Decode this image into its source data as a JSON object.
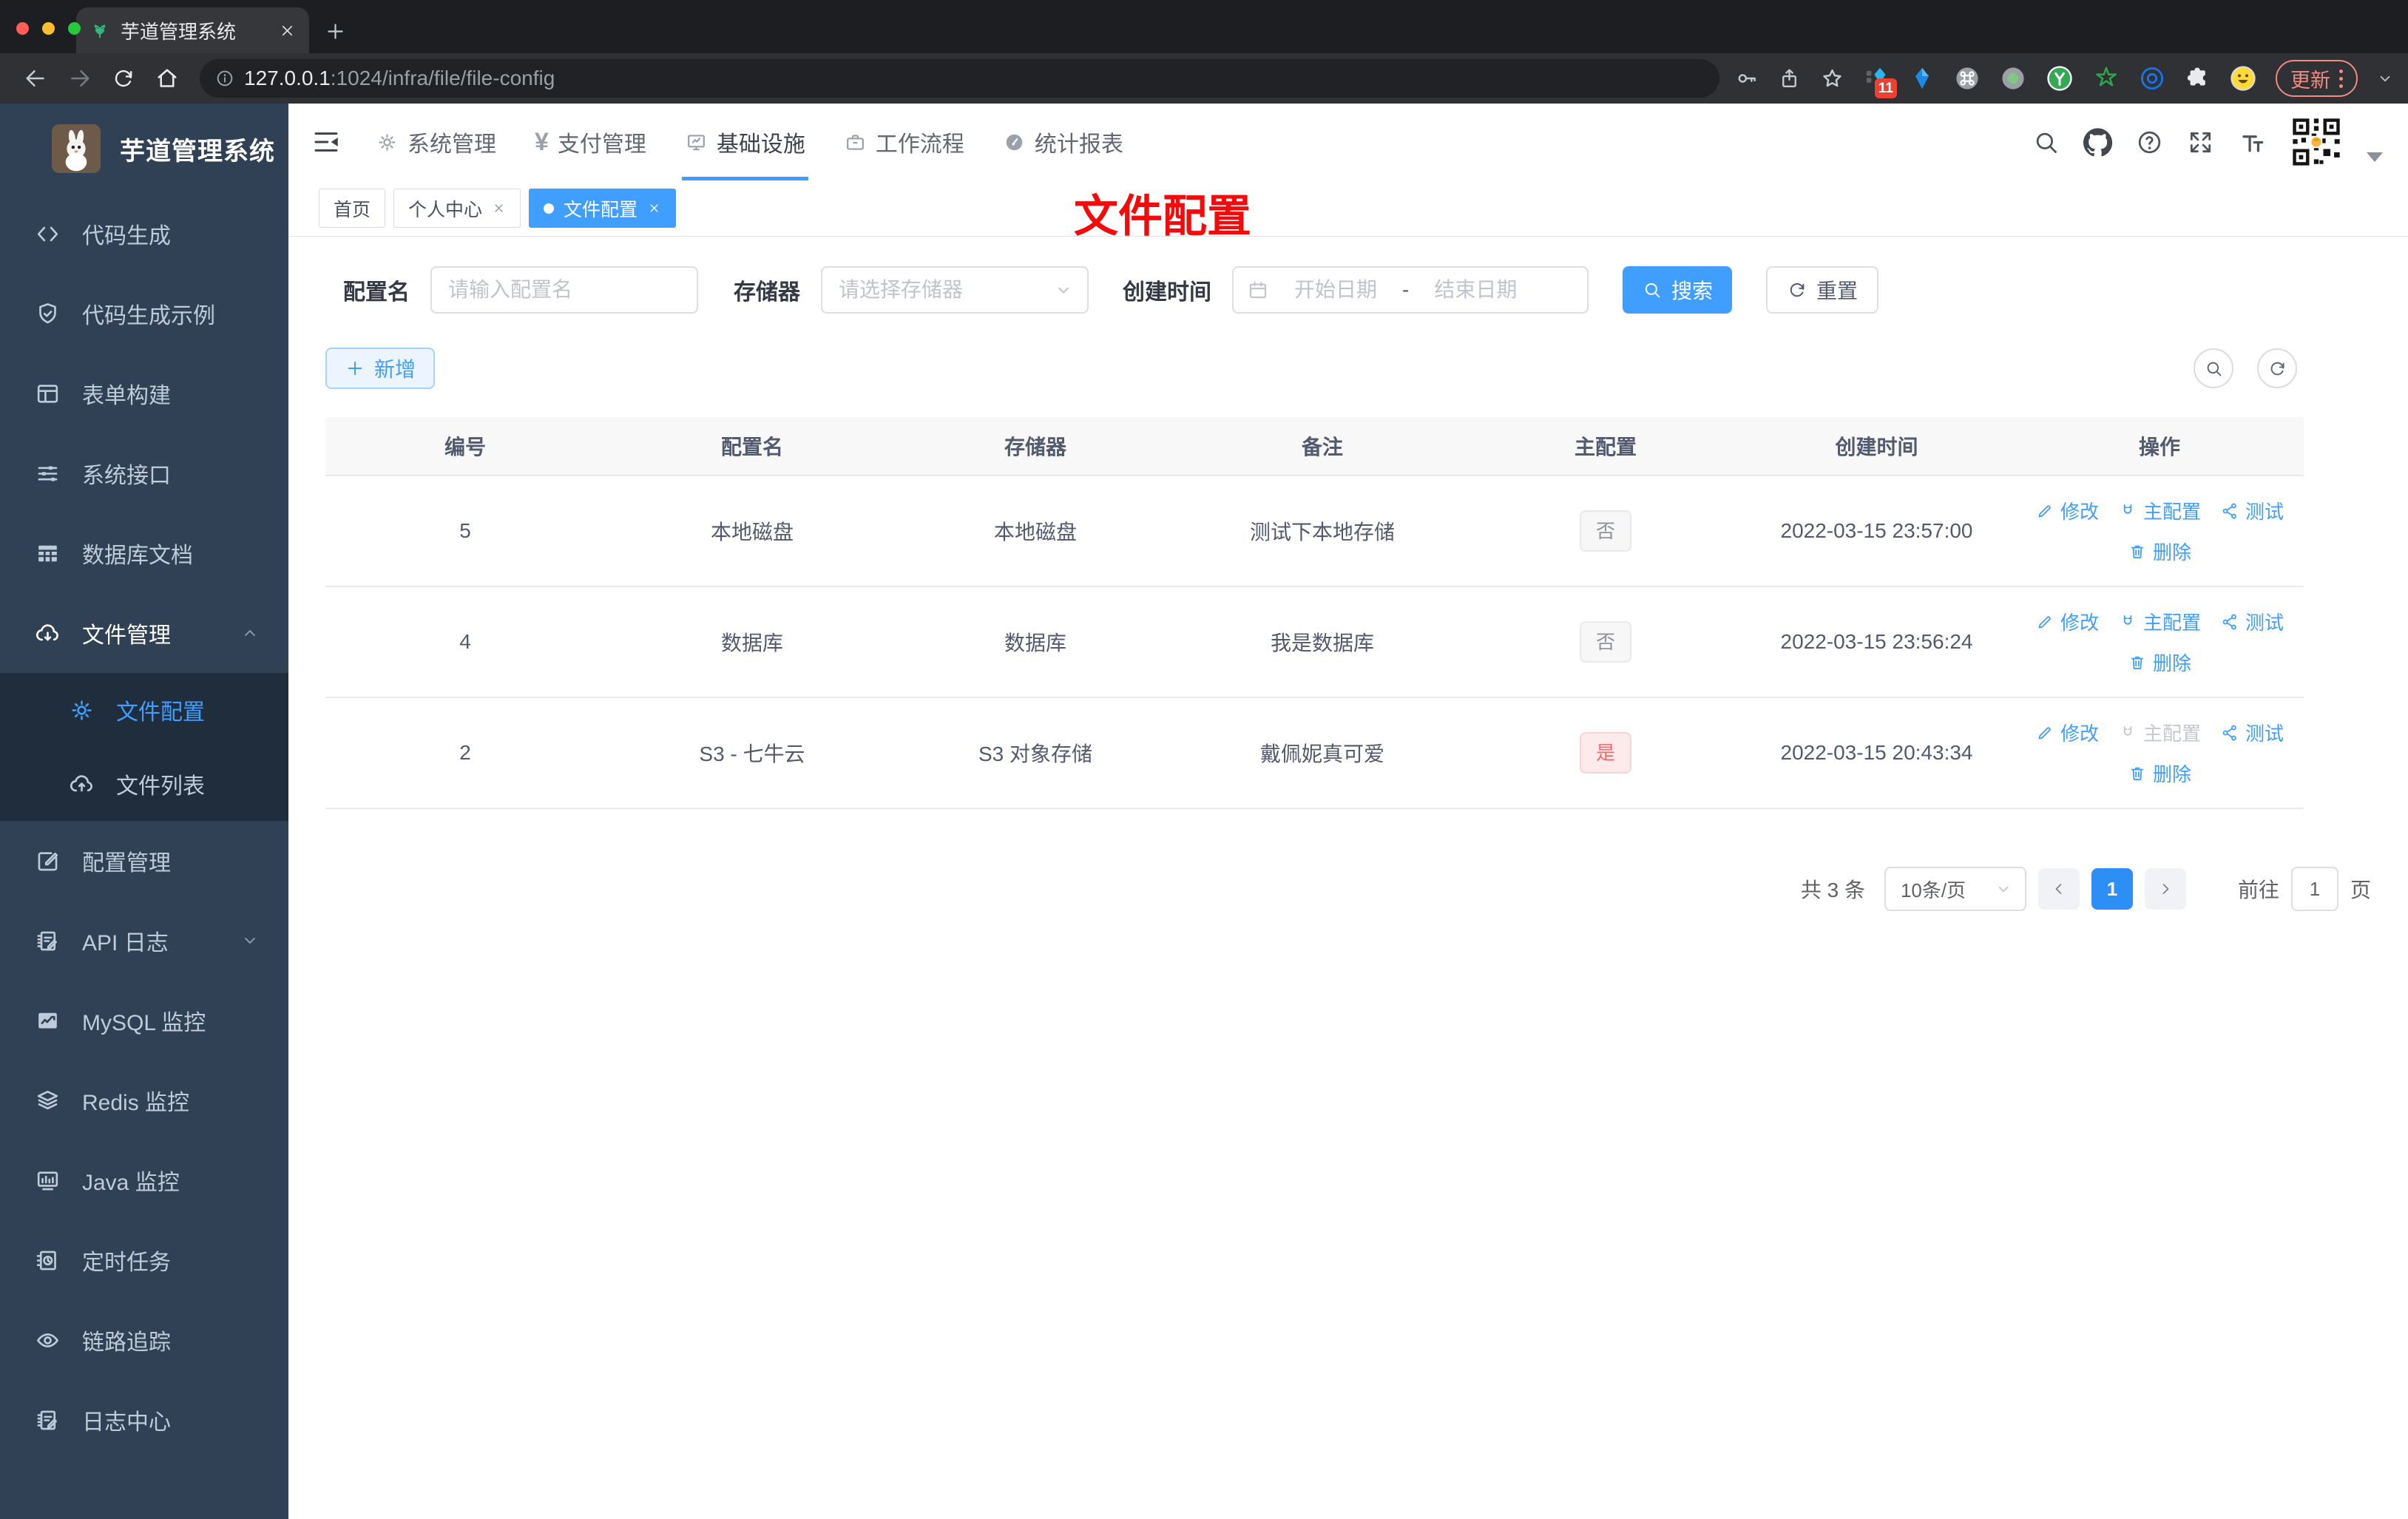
{
  "browser": {
    "tab_title": "芋道管理系统",
    "url_host": "127.0.0.1",
    "url_path": ":1024/infra/file/file-config",
    "extension_badge": "11",
    "update_label": "更新"
  },
  "sidebar": {
    "title": "芋道管理系统",
    "items": [
      {
        "label": "代码生成",
        "icon": "code-icon"
      },
      {
        "label": "代码生成示例",
        "icon": "shield-check-icon"
      },
      {
        "label": "表单构建",
        "icon": "form-icon"
      },
      {
        "label": "系统接口",
        "icon": "sliders-icon"
      },
      {
        "label": "数据库文档",
        "icon": "table-grid-icon"
      },
      {
        "label": "文件管理",
        "icon": "cloud-download-icon",
        "expanded": true
      },
      {
        "label": "文件配置",
        "icon": "gear-icon",
        "active": true,
        "sub": true
      },
      {
        "label": "文件列表",
        "icon": "cloud-upload-icon",
        "sub": true
      },
      {
        "label": "配置管理",
        "icon": "edit-square-icon"
      },
      {
        "label": "API 日志",
        "icon": "log-edit-icon",
        "collapsed": true
      },
      {
        "label": "MySQL 监控",
        "icon": "chart-monitor-icon"
      },
      {
        "label": "Redis 监控",
        "icon": "layers-icon"
      },
      {
        "label": "Java 监控",
        "icon": "java-monitor-icon"
      },
      {
        "label": "定时任务",
        "icon": "timer-icon"
      },
      {
        "label": "链路追踪",
        "icon": "eye-icon"
      },
      {
        "label": "日志中心",
        "icon": "log-edit-icon"
      }
    ]
  },
  "topnav": {
    "menus": [
      {
        "label": "系统管理",
        "icon": "gear-icon"
      },
      {
        "label": "支付管理",
        "icon": "yen-icon"
      },
      {
        "label": "基础设施",
        "icon": "monitor-icon",
        "active": true
      },
      {
        "label": "工作流程",
        "icon": "briefcase-icon"
      },
      {
        "label": "统计报表",
        "icon": "gauge-icon"
      }
    ]
  },
  "tags": [
    {
      "label": "首页",
      "closable": false,
      "active": false
    },
    {
      "label": "个人中心",
      "closable": true,
      "active": false
    },
    {
      "label": "文件配置",
      "closable": true,
      "active": true
    }
  ],
  "annotation": {
    "text": "文件配置",
    "color": "#f30b0b"
  },
  "filters": {
    "name_label": "配置名",
    "name_placeholder": "请输入配置名",
    "storage_label": "存储器",
    "storage_placeholder": "请选择存储器",
    "date_label": "创建时间",
    "date_start_placeholder": "开始日期",
    "date_separator": "-",
    "date_end_placeholder": "结束日期",
    "search_label": "搜索",
    "reset_label": "重置"
  },
  "toolbar": {
    "add_label": "新增"
  },
  "table": {
    "columns": [
      "编号",
      "配置名",
      "存储器",
      "备注",
      "主配置",
      "创建时间",
      "操作"
    ],
    "actions": {
      "edit": "修改",
      "master": "主配置",
      "test": "测试",
      "remove": "删除"
    },
    "rows": [
      {
        "id": "5",
        "name": "本地磁盘",
        "storage": "本地磁盘",
        "remark": "测试下本地存储",
        "master": "否",
        "created": "2022-03-15 23:57:00",
        "master_disabled": false
      },
      {
        "id": "4",
        "name": "数据库",
        "storage": "数据库",
        "remark": "我是数据库",
        "master": "否",
        "created": "2022-03-15 23:56:24",
        "master_disabled": false
      },
      {
        "id": "2",
        "name": "S3 - 七牛云",
        "storage": "S3 对象存储",
        "remark": "戴佩妮真可爱",
        "master": "是",
        "created": "2022-03-15 20:43:34",
        "master_disabled": true
      }
    ]
  },
  "pagination": {
    "total": "共 3 条",
    "page_size": "10条/页",
    "current": "1",
    "goto_label": "前往",
    "goto_value": "1",
    "page_unit": "页"
  },
  "colors": {
    "accent": "#409eff",
    "sidebar_bg": "#304156",
    "sidebar_submenu_bg": "#1f2d3d",
    "link_blue": "#409eff",
    "danger": "#f56c6c",
    "annotation_red": "#f30b0b",
    "badge_no_text": "#909399",
    "badge_yes_text": "#f16a6a",
    "tag_active_bg": "#409eff"
  },
  "icons": {
    "leaf-favicon": "green sprout glyph",
    "search-icon": "magnifier",
    "github-icon": "octocat mark",
    "question-icon": "circled ?",
    "fullscreen-icon": "expand arrows",
    "font-size-icon": "Tt glyph",
    "qr-avatar": "qr-code image",
    "fold-icon": "menu lines + left triangle",
    "calendar-icon": "calendar",
    "refresh-icon": "circular arrow",
    "plus-icon": "+",
    "edit-icon": "pen",
    "master-icon": "magnet U",
    "test-icon": "share nodes",
    "delete-icon": "trash can"
  }
}
